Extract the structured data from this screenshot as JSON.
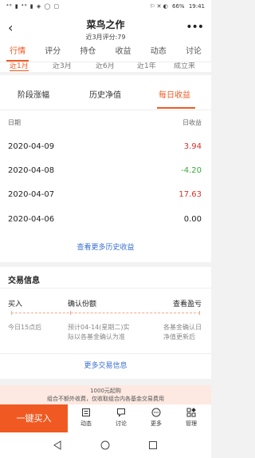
{
  "status_bar": {
    "left": "⁴⁶ ▮ ⁴⁶ ▮ ◈ ◯ ▢",
    "icons": "⚐ ✕ ◐",
    "battery": "66%",
    "time": "19:41"
  },
  "header": {
    "back_icon": "‹",
    "title": "菜鸟之作",
    "subtitle": "近3月评分:79",
    "more_icon": "•••"
  },
  "tabs": [
    {
      "label": "行情"
    },
    {
      "label": "评分"
    },
    {
      "label": "持仓"
    },
    {
      "label": "收益"
    },
    {
      "label": "动态"
    },
    {
      "label": "讨论"
    }
  ],
  "periods": [
    "近1月",
    "近3月",
    "近6月",
    "近1年",
    "成立来"
  ],
  "subtabs": [
    "阶段涨幅",
    "历史净值",
    "每日收益"
  ],
  "daily": {
    "col_date": "日期",
    "col_value": "日收益",
    "rows": [
      {
        "date": "2020-04-09",
        "value": "3.94"
      },
      {
        "date": "2020-04-08",
        "value": "-4.20"
      },
      {
        "date": "2020-04-07",
        "value": "17.63"
      },
      {
        "date": "2020-04-06",
        "value": "0.00"
      }
    ],
    "more_link": "查看更多历史收益"
  },
  "trade": {
    "title": "交易信息",
    "steps": [
      {
        "label": "买入",
        "desc_line1": "今日15点后",
        "desc_line2": ""
      },
      {
        "label": "确认份额",
        "desc_line1": "预计04-14(星期二)实",
        "desc_line2": "际以各基金确认为准"
      },
      {
        "label": "查看盈亏",
        "desc_line1": "各基金确认日",
        "desc_line2": "净值更新后"
      }
    ],
    "more_link": "更多交易信息"
  },
  "notice": {
    "line1": "1000元起购",
    "line2": "组合不额外收费，仅收取组合内各基金交易费用"
  },
  "bottom_bar": {
    "buy": "一键买入",
    "items": [
      {
        "label": "动态",
        "icon": "list-icon"
      },
      {
        "label": "讨论",
        "icon": "chat-icon"
      },
      {
        "label": "更多",
        "icon": "more-dots-icon"
      },
      {
        "label": "管理",
        "icon": "grid-icon"
      }
    ]
  },
  "colors": {
    "accent": "#f05a22",
    "up": "#d9322b",
    "down": "#3aa83a",
    "link": "#3a6fd1"
  }
}
